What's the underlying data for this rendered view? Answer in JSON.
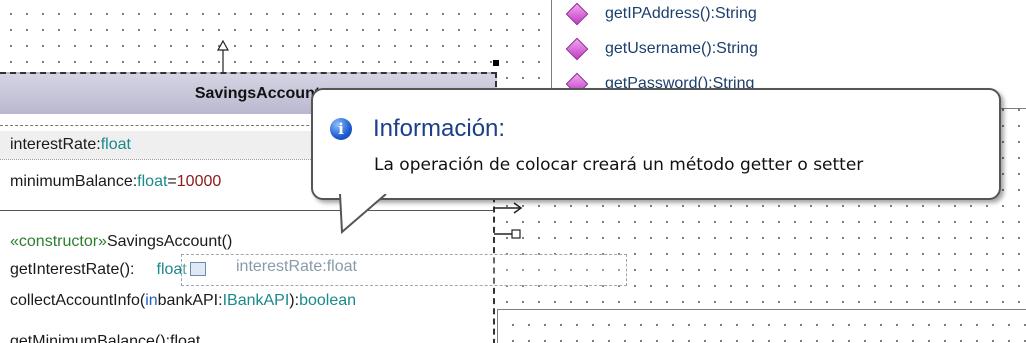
{
  "right_class": {
    "operations": [
      "getIPAddress():String",
      "getUsername():String",
      "getPassword():String"
    ]
  },
  "savings_account": {
    "title": "SavingsAccount",
    "attributes": [
      {
        "name": "interestRate",
        "sep": ":",
        "type": "float",
        "default": ""
      },
      {
        "name": "minimumBalance",
        "sep": ":",
        "type": "float",
        "eq": "=",
        "default": "10000"
      }
    ],
    "operations": {
      "constructor_stereotype": "«constructor»",
      "constructor": " SavingsAccount()",
      "get_interest_rate_name": "getInterestRate():",
      "get_interest_rate_type": "float",
      "collect_name": "collectAccountInfo(",
      "collect_in": "in",
      "collect_param": " bankAPI:",
      "collect_param_type": "IBankAPI",
      "collect_close": "):",
      "collect_return": "boolean",
      "partial_last": "getMinimumBalance():float"
    }
  },
  "tooltip": {
    "icon": "info-icon",
    "title": "Información:",
    "message": "La operación de colocar creará un método getter o setter"
  },
  "drag_ghost": {
    "label_name": "interestRate",
    "label_sep": ":",
    "label_type": "float"
  },
  "colors": {
    "type": "#1a8a8a",
    "keyword": "#2e7d2e",
    "number": "#8b1a1a",
    "tooltip_title": "#1b3f88"
  }
}
